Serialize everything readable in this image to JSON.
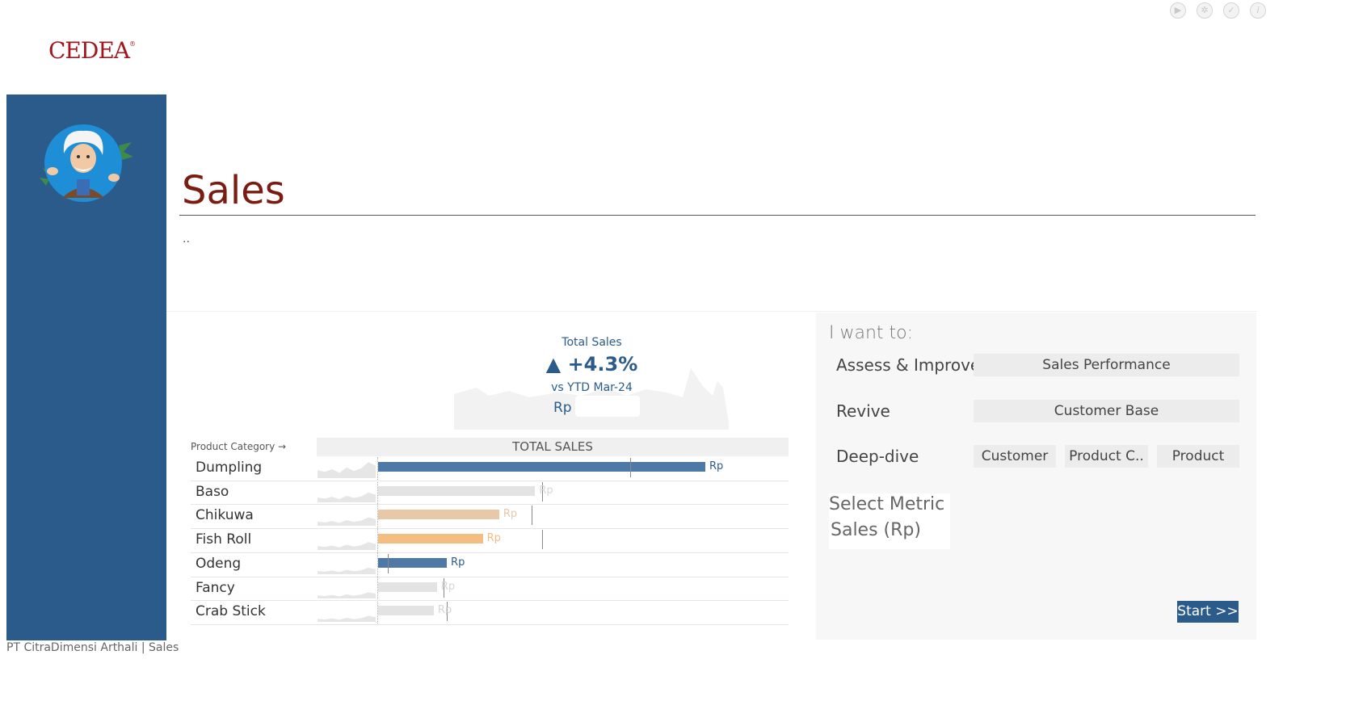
{
  "toolbar": {
    "icons": [
      "play-icon",
      "settings-icon",
      "check-icon",
      "info-icon"
    ],
    "glyphs": [
      "▶",
      "✲",
      "✓",
      "i"
    ]
  },
  "brand": {
    "logo_text": "CEDEA",
    "logo_mark": "®",
    "color": "#a0181f"
  },
  "sidebar": {
    "color": "#2b5b8a"
  },
  "header": {
    "title": "Sales",
    "subtitle": "..",
    "title_color": "#7a1c12"
  },
  "kpi": {
    "label": "Total Sales",
    "change": "▲ +4.3%",
    "comparison": "vs  YTD Mar-24",
    "currency": "Rp"
  },
  "table": {
    "category_header": "Product Category →",
    "sales_header": "TOTAL SALES",
    "rows": [
      {
        "category": "Dumpling",
        "value_label": "Rp",
        "share": 1.0,
        "target": 0.77,
        "color": "#4e79a7"
      },
      {
        "category": "Baso",
        "value_label": "Rp",
        "share": 0.48,
        "target": 0.5,
        "color": "#e3e3e3"
      },
      {
        "category": "Chikuwa",
        "value_label": "Rp",
        "share": 0.37,
        "target": 0.47,
        "color": "#e7c9a9"
      },
      {
        "category": "Fish Roll",
        "value_label": "Rp",
        "share": 0.32,
        "target": 0.5,
        "color": "#f4be82"
      },
      {
        "category": "Odeng",
        "value_label": "Rp",
        "share": 0.21,
        "target": 0.03,
        "color": "#4e79a7"
      },
      {
        "category": "Fancy",
        "value_label": "Rp",
        "share": 0.18,
        "target": 0.2,
        "color": "#e3e3e3"
      },
      {
        "category": "Crab Stick",
        "value_label": "Rp",
        "share": 0.17,
        "target": 0.21,
        "color": "#e3e3e3"
      }
    ]
  },
  "panel": {
    "heading": "I want to:",
    "actions": [
      {
        "label": "Assess & Improve",
        "buttons": [
          "Sales Performance"
        ]
      },
      {
        "label": "Revive",
        "buttons": [
          "Customer Base"
        ]
      },
      {
        "label": "Deep-dive",
        "buttons": [
          "Customer",
          "Product C..",
          "Product"
        ]
      }
    ],
    "metric_title": "Select Metric",
    "metric_value": "Sales (Rp)",
    "start_label": "Start >>"
  },
  "footer": {
    "text": "PT CitraDimensi Arthali | Sales"
  }
}
